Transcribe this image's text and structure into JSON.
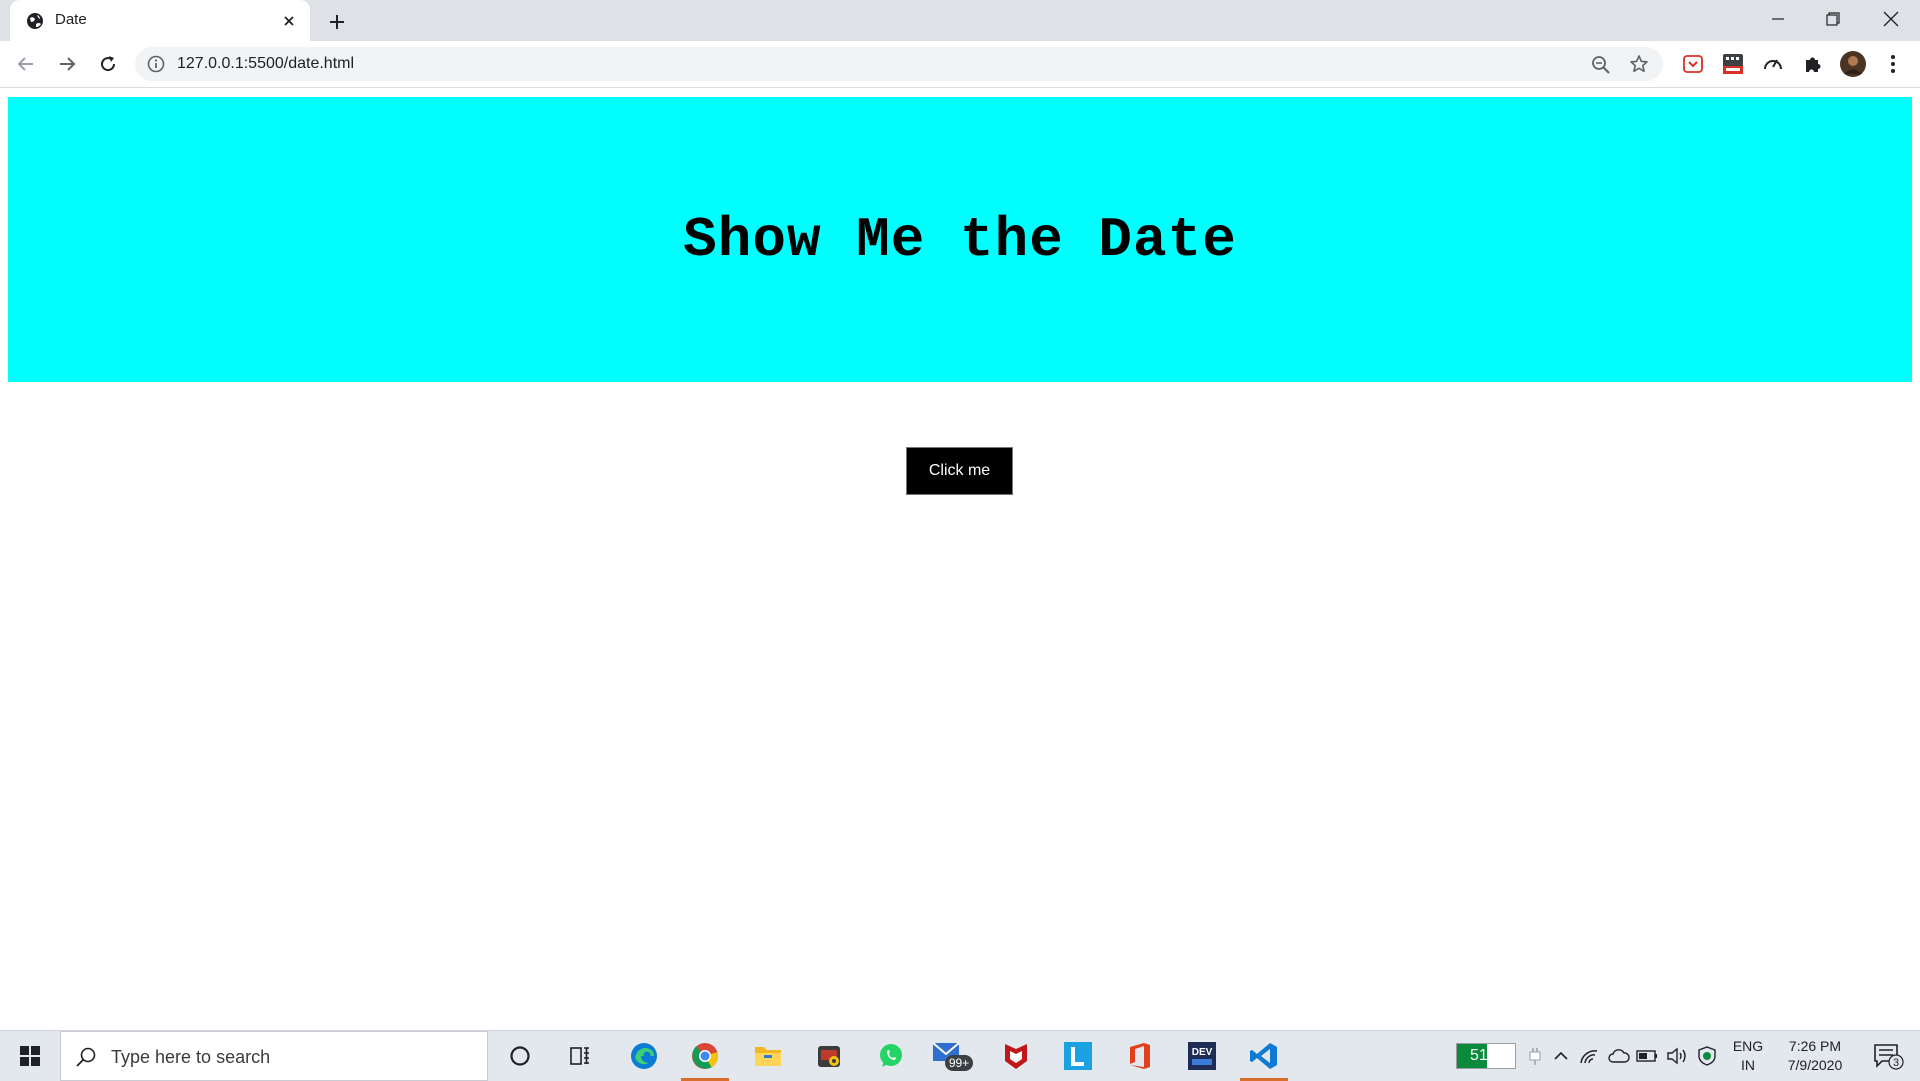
{
  "browser": {
    "tab": {
      "title": "Date",
      "favicon": "globe-icon"
    },
    "newtab_icon": "plus-icon",
    "window_controls": [
      "minimize-icon",
      "restore-icon",
      "close-icon"
    ],
    "address": {
      "url": "127.0.0.1:5500/date.html",
      "info_icon": "info-icon"
    },
    "nav_icons": [
      "back-icon",
      "forward-icon",
      "reload-icon"
    ],
    "extensions": [
      "pocket-icon",
      "coupon-off-icon",
      "speed-icon",
      "puzzle-icon",
      "profile-avatar",
      "menu-kebab-icon"
    ]
  },
  "page": {
    "heading": "Show Me the Date",
    "button_label": "Click me",
    "colors": {
      "hero_bg": "#00ffff",
      "button_bg": "#000000",
      "button_text": "#ffffff"
    }
  },
  "taskbar": {
    "search_placeholder": "Type here to search",
    "pinned": [
      "cortana-icon",
      "task-view-icon",
      "edge-icon",
      "chrome-icon",
      "file-explorer-icon",
      "camera-app-icon",
      "whatsapp-icon",
      "mail-icon",
      "mcafee-icon",
      "lens-l-icon",
      "office-icon",
      "devc-icon",
      "vscode-icon"
    ],
    "mail_badge": "99+",
    "battery_percent": 51,
    "battery_text": "51%",
    "lang_line1": "ENG",
    "lang_line2": "IN",
    "time": "7:26 PM",
    "date": "7/9/2020",
    "notification_count": "3"
  }
}
